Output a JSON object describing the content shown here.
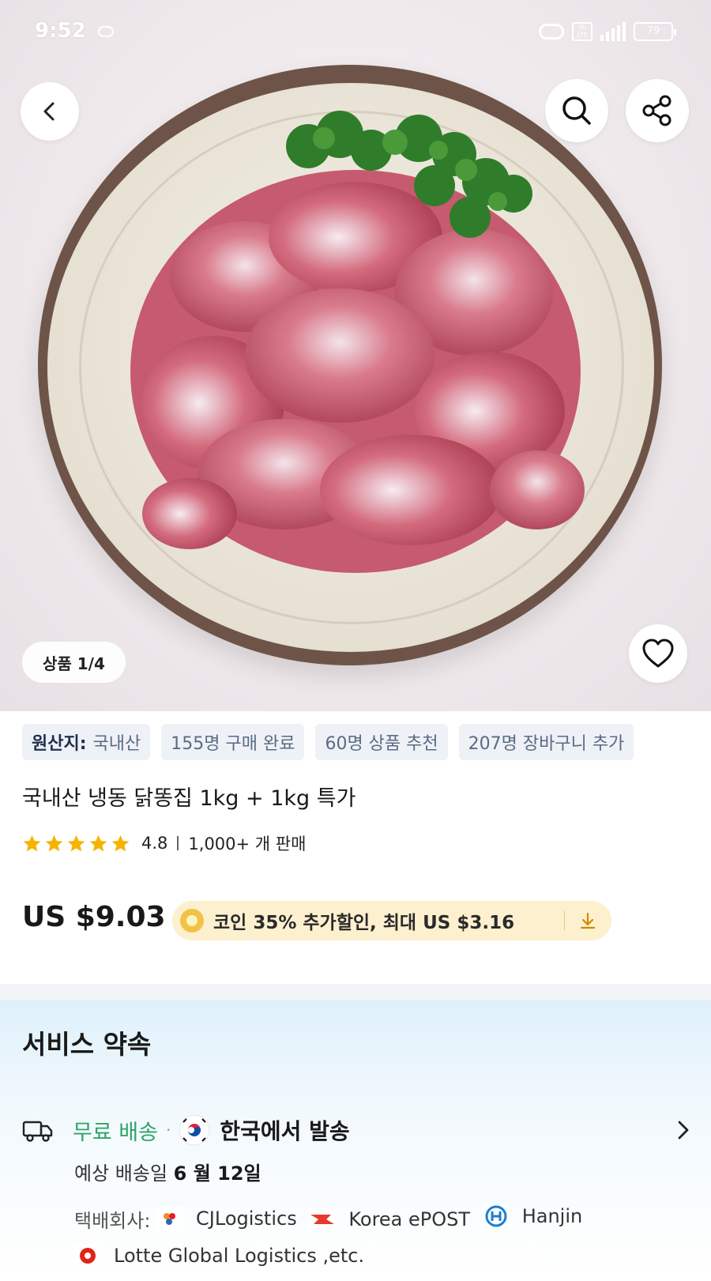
{
  "status_bar": {
    "time": "9:52",
    "network": "LTE",
    "battery": "79"
  },
  "gallery": {
    "page_label": "상품 1/4"
  },
  "tags": [
    {
      "label": "원산지:",
      "value": "국내산"
    },
    {
      "value": "155명 구매 완료"
    },
    {
      "value": "60명 상품 추천"
    },
    {
      "value": "207명 장바구니 추가"
    }
  ],
  "product": {
    "title": "국내산 냉동 닭똥집 1kg + 1kg 특가",
    "rating": "4.8",
    "stars": 5,
    "sold": "1,000+ 개 판매",
    "price": "US $9.03",
    "coin_offer": "코인 35% 추가할인, 최대 US $3.16"
  },
  "service": {
    "title": "서비스 약속",
    "free_shipping": "무료 배송",
    "separator": "·",
    "ship_from": "한국에서 발송",
    "eta_prefix": "예상 배송일",
    "eta_date": "6 월 12일",
    "courier_label": "택배회사:",
    "couriers": [
      "CJLogistics",
      "Korea ePOST",
      "Hanjin",
      "Lotte Global Logistics ,etc."
    ]
  },
  "colors": {
    "accent_green": "#2fa36a",
    "star_yellow": "#f5b400",
    "coin_bg": "#fdf0cf",
    "tag_bg": "#eef1f6"
  }
}
